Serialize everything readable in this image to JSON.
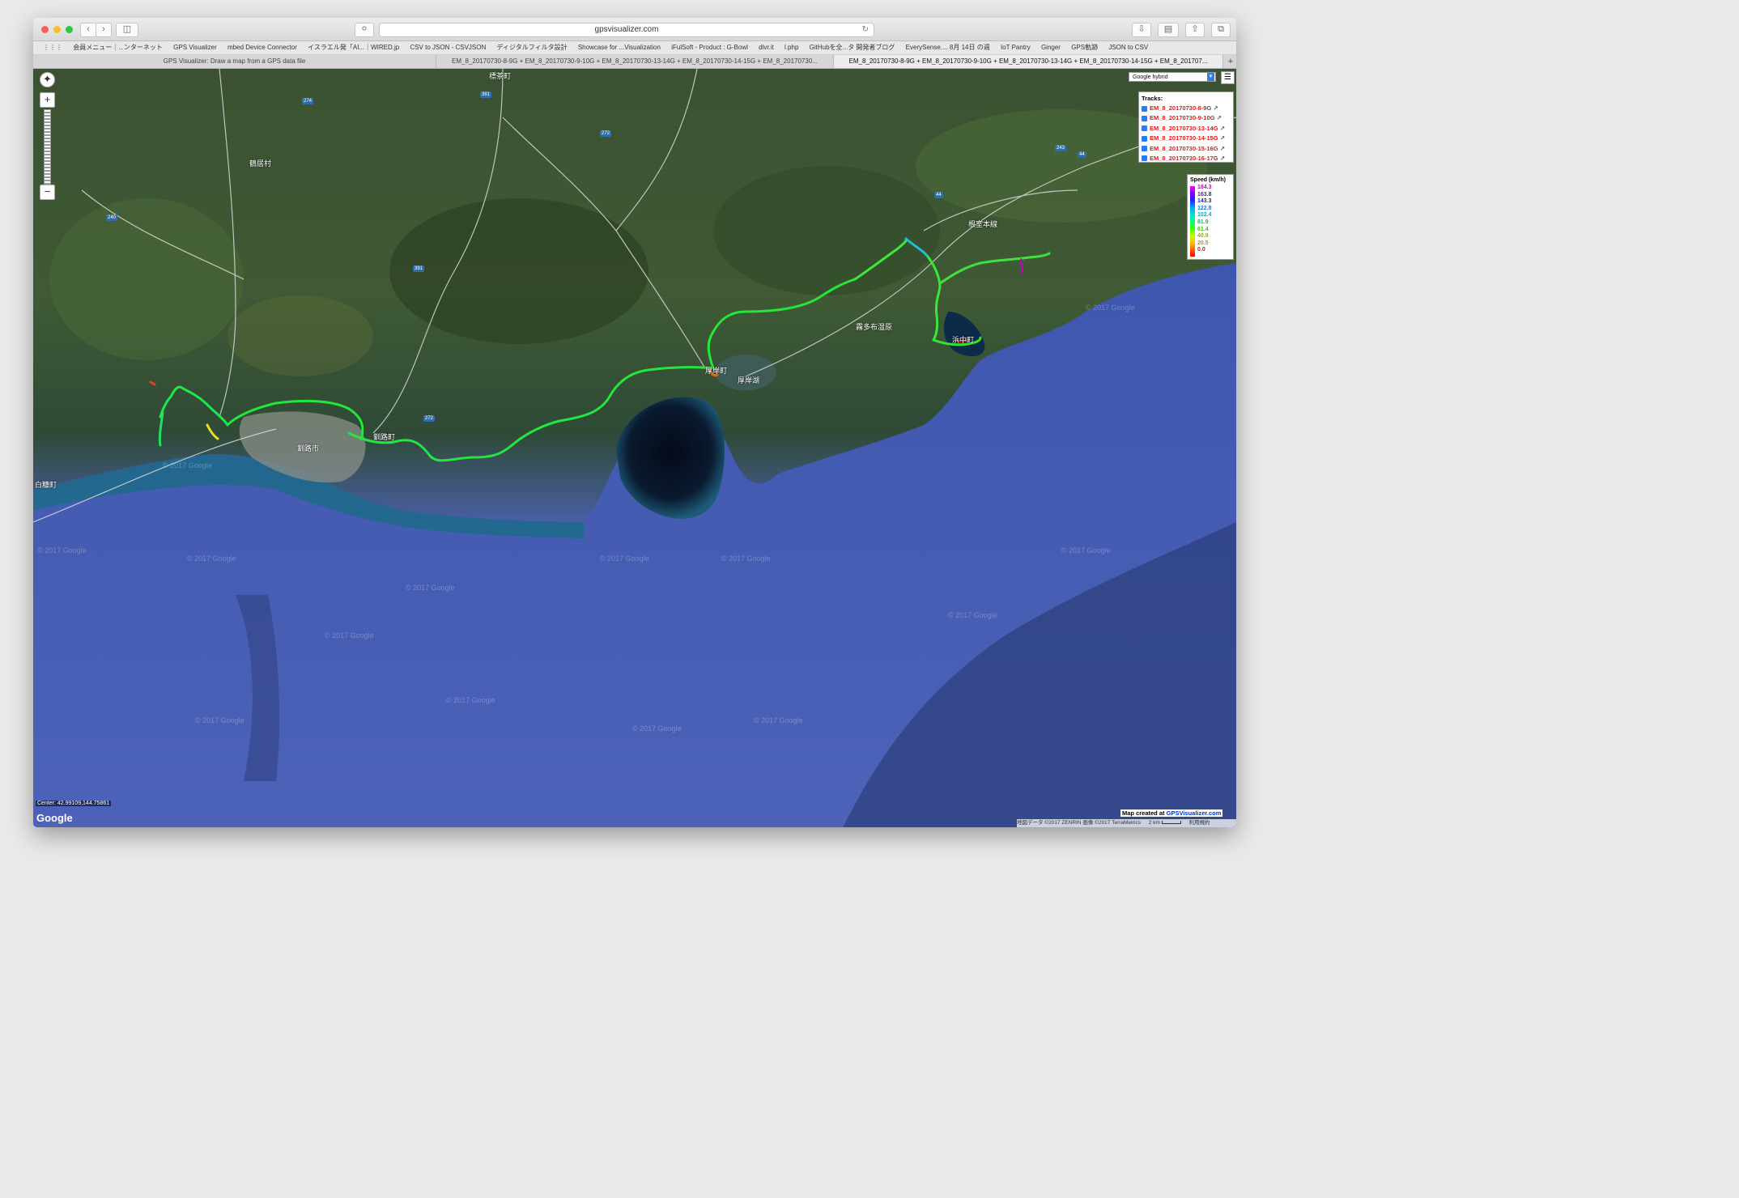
{
  "browser": {
    "url": "gpsvisualizer.com",
    "bookmarks": [
      "会員メニュー｜...ンターネット",
      "GPS Visualizer",
      "mbed Device Connector",
      "イスラエル発「AI...｜WIRED.jp",
      "CSV to JSON - CSVJSON",
      "ディジタルフィルタ設計",
      "Showcase for ...Visualization",
      "iFulSoft - Product : G-Bowl",
      "dlvr.it",
      "l.php",
      "GitHubを全...タ 開発者ブログ",
      "EverySense.... 8月 14日 の週",
      "IoT Pantry",
      "Ginger",
      "GPS軌跡",
      "JSON to CSV"
    ],
    "tabs": [
      {
        "label": "GPS Visualizer: Draw a map from a GPS data file"
      },
      {
        "label": "EM_8_20170730-8-9G + EM_8_20170730-9-10G + EM_8_20170730-13-14G + EM_8_20170730-14-15G + EM_8_20170730..."
      },
      {
        "label": "EM_8_20170730-8-9G + EM_8_20170730-9-10G + EM_8_20170730-13-14G + EM_8_20170730-14-15G + EM_8_201707..."
      }
    ]
  },
  "map": {
    "type_selector": "Google hybrid",
    "menu_icon": "hamburger-icon",
    "tracks_title": "Tracks:",
    "tracks": [
      {
        "name": "EM_8_20170730-8-9G"
      },
      {
        "name": "EM_8_20170730-9-10G"
      },
      {
        "name": "EM_8_20170730-13-14G"
      },
      {
        "name": "EM_8_20170730-14-15G"
      },
      {
        "name": "EM_8_20170730-15-16G"
      },
      {
        "name": "EM_8_20170730-16-17G"
      }
    ],
    "legend_title": "Speed (km/h)",
    "legend_values": [
      "184.3",
      "163.8",
      "143.3",
      "122.8",
      "102.4",
      "81.9",
      "61.4",
      "40.9",
      "20.5",
      "0.0"
    ],
    "legend_colors": [
      "#d000d0",
      "#7000e0",
      "#2020f0",
      "#0080ff",
      "#00b0c0",
      "#00c060",
      "#40c000",
      "#a0b000",
      "#e08000",
      "#e01010"
    ],
    "center": "Center: 42.99109,144.75861",
    "google_logo": "Google",
    "credit_prefix": "Map created at",
    "credit_link": "GPSVisualizer.com",
    "attribution": "地図データ ©2017 ZENRIN 画像 ©2017 TerraMetrics",
    "scale": "2 km",
    "terms": "利用規約",
    "watermark": "© 2017 Google",
    "places": [
      "標茶町",
      "鶴居村",
      "釧路町",
      "釧路市",
      "白糠町",
      "厚岸町",
      "厚岸湖",
      "霧多布湿原",
      "浜中町",
      "根室本線"
    ],
    "road_shields": [
      "274",
      "391",
      "272",
      "243",
      "44",
      "240",
      "391",
      "272",
      "44"
    ]
  }
}
